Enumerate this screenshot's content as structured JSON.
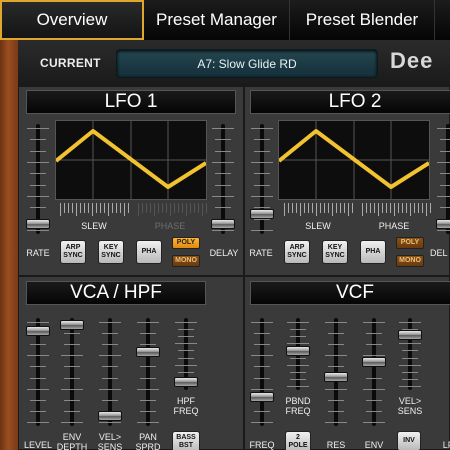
{
  "tabs": [
    {
      "label": "Overview",
      "active": true
    },
    {
      "label": "Preset Manager",
      "active": false
    },
    {
      "label": "Preset Blender",
      "active": false
    }
  ],
  "header": {
    "current_label": "CURRENT",
    "preset_display": "A7:  Slow Glide RD",
    "brand_text": "Dee"
  },
  "lfo1": {
    "title": "LFO 1",
    "slew_label": "SLEW",
    "phase_label": "PHASE",
    "rate_label": "RATE",
    "delay_label": "DELAY",
    "buttons": {
      "arp_sync": "ARP SYNC",
      "key_sync": "KEY SYNC",
      "pha": "PHA",
      "poly": "POLY",
      "mono": "MONO"
    },
    "rate_level": 0.05,
    "delay_level": 0.05
  },
  "lfo2": {
    "title": "LFO 2",
    "slew_label": "SLEW",
    "phase_label": "PHASE",
    "rate_label": "RATE",
    "delay_label": "DEL",
    "buttons": {
      "arp_sync": "ARP SYNC",
      "key_sync": "KEY SYNC",
      "pha": "PHA",
      "poly": "POLY",
      "mono": "MONO"
    },
    "rate_level": 0.15
  },
  "vca": {
    "title": "VCA / HPF",
    "labels": [
      "LEVEL",
      "ENV DEPTH",
      "VEL> SENS",
      "PAN SPRD",
      "HPF FREQ"
    ],
    "levels": [
      0.92,
      0.98,
      0.05,
      0.7,
      0.05
    ],
    "bass_boost": "BASS BST"
  },
  "vcf": {
    "title": "VCF",
    "labels": [
      "FREQ",
      "PBND FREQ",
      "RES",
      "ENV",
      "VEL> SENS",
      "LF"
    ],
    "levels": [
      0.25,
      0.55,
      0.45,
      0.6,
      0.8
    ],
    "two_pole": "2 POLE",
    "inv": "INV"
  },
  "colors": {
    "accent": "#e0a82a",
    "wave": "#f2c230",
    "panel": "#3a3a3a",
    "poly_button": "#ffb530",
    "mono_button": "#6a3a0e"
  }
}
